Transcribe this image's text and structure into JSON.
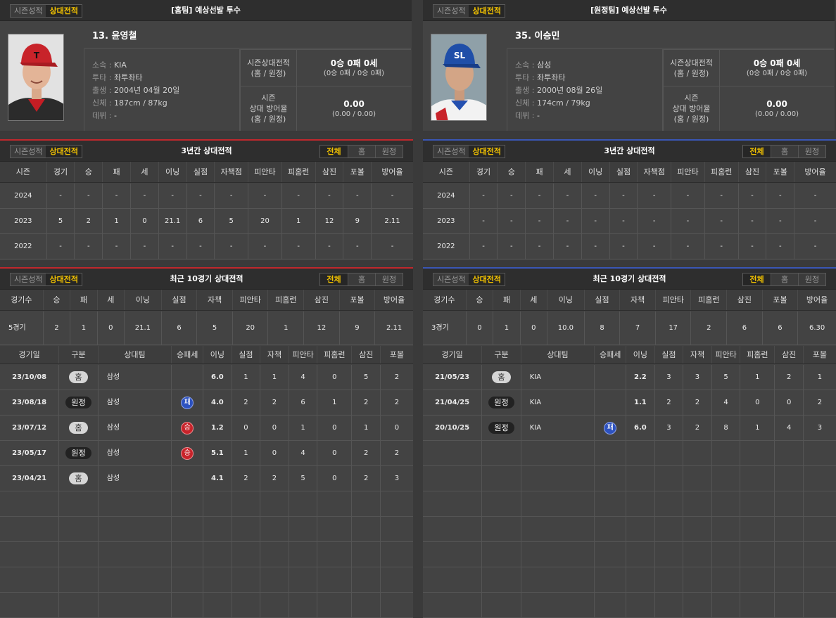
{
  "toggle": {
    "season": "시즌성적",
    "h2h": "상대전적"
  },
  "seg": {
    "all": "전체",
    "home": "홈",
    "away": "원정"
  },
  "home": {
    "title": "[홈팀] 예상선발 투수",
    "player_name": "13. 윤영철",
    "info": [
      {
        "label": "소속 : ",
        "value": "KIA"
      },
      {
        "label": "투타 : ",
        "value": "좌투좌타"
      },
      {
        "label": "출생 : ",
        "value": "2004년 04월 20일"
      },
      {
        "label": "신체 : ",
        "value": "187cm / 87kg"
      },
      {
        "label": "데뷔 : ",
        "value": "-"
      }
    ],
    "stat_record": {
      "label1": "시즌상대전적",
      "label2": "(홈 / 원정)",
      "value": "0승 0패 0세",
      "sub": "(0승 0패 / 0승 0패)"
    },
    "stat_era": {
      "label1": "시즌",
      "label2": "상대 방어율",
      "label3": "(홈 / 원정)",
      "value": "0.00",
      "sub": "(0.00 / 0.00)"
    },
    "three_year": {
      "title": "3년간 상대전적",
      "headers": [
        "시즌",
        "경기",
        "승",
        "패",
        "세",
        "이닝",
        "실점",
        "자책점",
        "피안타",
        "피홈런",
        "삼진",
        "포볼",
        "방어율"
      ],
      "rows": [
        [
          "2024",
          "-",
          "-",
          "-",
          "-",
          "-",
          "-",
          "-",
          "-",
          "-",
          "-",
          "-",
          "-"
        ],
        [
          "2023",
          "5",
          "2",
          "1",
          "0",
          "21.1",
          "6",
          "5",
          "20",
          "1",
          "12",
          "9",
          "2.11"
        ],
        [
          "2022",
          "-",
          "-",
          "-",
          "-",
          "-",
          "-",
          "-",
          "-",
          "-",
          "-",
          "-",
          "-"
        ]
      ]
    },
    "recent": {
      "title": "최근 10경기 상대전적",
      "headers": [
        "경기수",
        "승",
        "패",
        "세",
        "이닝",
        "실점",
        "자책",
        "피안타",
        "피홈런",
        "삼진",
        "포볼",
        "방어율"
      ],
      "summary": [
        "5경기",
        "2",
        "1",
        "0",
        "21.1",
        "6",
        "5",
        "20",
        "1",
        "12",
        "9",
        "2.11"
      ],
      "game_headers": [
        "경기일",
        "구분",
        "상대팀",
        "승패세",
        "이닝",
        "실점",
        "자책",
        "피안타",
        "피홈런",
        "삼진",
        "포볼"
      ],
      "games": [
        {
          "date": "23/10/08",
          "type": "홈",
          "opp": "삼성",
          "result": "",
          "ip": "6.0",
          "r": "1",
          "er": "1",
          "h": "4",
          "hr": "0",
          "so": "5",
          "bb": "2"
        },
        {
          "date": "23/08/18",
          "type": "원정",
          "opp": "삼성",
          "result": "패",
          "ip": "4.0",
          "r": "2",
          "er": "2",
          "h": "6",
          "hr": "1",
          "so": "2",
          "bb": "2"
        },
        {
          "date": "23/07/12",
          "type": "홈",
          "opp": "삼성",
          "result": "승",
          "ip": "1.2",
          "r": "0",
          "er": "0",
          "h": "1",
          "hr": "0",
          "so": "1",
          "bb": "0"
        },
        {
          "date": "23/05/17",
          "type": "원정",
          "opp": "삼성",
          "result": "승",
          "ip": "5.1",
          "r": "1",
          "er": "0",
          "h": "4",
          "hr": "0",
          "so": "2",
          "bb": "2"
        },
        {
          "date": "23/04/21",
          "type": "홈",
          "opp": "삼성",
          "result": "",
          "ip": "4.1",
          "r": "2",
          "er": "2",
          "h": "5",
          "hr": "0",
          "so": "2",
          "bb": "3"
        }
      ]
    }
  },
  "away": {
    "title": "[원정팀] 예상선발 투수",
    "player_name": "35. 이승민",
    "info": [
      {
        "label": "소속 : ",
        "value": "삼성"
      },
      {
        "label": "투타 : ",
        "value": "좌투좌타"
      },
      {
        "label": "출생 : ",
        "value": "2000년 08월 26일"
      },
      {
        "label": "신체 : ",
        "value": "174cm / 79kg"
      },
      {
        "label": "데뷔 : ",
        "value": "-"
      }
    ],
    "stat_record": {
      "label1": "시즌상대전적",
      "label2": "(홈 / 원정)",
      "value": "0승 0패 0세",
      "sub": "(0승 0패 / 0승 0패)"
    },
    "stat_era": {
      "label1": "시즌",
      "label2": "상대 방어율",
      "label3": "(홈 / 원정)",
      "value": "0.00",
      "sub": "(0.00 / 0.00)"
    },
    "three_year": {
      "title": "3년간 상대전적",
      "headers": [
        "시즌",
        "경기",
        "승",
        "패",
        "세",
        "이닝",
        "실점",
        "자책점",
        "피안타",
        "피홈런",
        "삼진",
        "포볼",
        "방어율"
      ],
      "rows": [
        [
          "2024",
          "-",
          "-",
          "-",
          "-",
          "-",
          "-",
          "-",
          "-",
          "-",
          "-",
          "-",
          "-"
        ],
        [
          "2023",
          "-",
          "-",
          "-",
          "-",
          "-",
          "-",
          "-",
          "-",
          "-",
          "-",
          "-",
          "-"
        ],
        [
          "2022",
          "-",
          "-",
          "-",
          "-",
          "-",
          "-",
          "-",
          "-",
          "-",
          "-",
          "-",
          "-"
        ]
      ]
    },
    "recent": {
      "title": "최근 10경기 상대전적",
      "headers": [
        "경기수",
        "승",
        "패",
        "세",
        "이닝",
        "실점",
        "자책",
        "피안타",
        "피홈런",
        "삼진",
        "포볼",
        "방어율"
      ],
      "summary": [
        "3경기",
        "0",
        "1",
        "0",
        "10.0",
        "8",
        "7",
        "17",
        "2",
        "6",
        "6",
        "6.30"
      ],
      "game_headers": [
        "경기일",
        "구분",
        "상대팀",
        "승패세",
        "이닝",
        "실점",
        "자책",
        "피안타",
        "피홈런",
        "삼진",
        "포볼"
      ],
      "games": [
        {
          "date": "21/05/23",
          "type": "홈",
          "opp": "KIA",
          "result": "",
          "ip": "2.2",
          "r": "3",
          "er": "3",
          "h": "5",
          "hr": "1",
          "so": "2",
          "bb": "1"
        },
        {
          "date": "21/04/25",
          "type": "원정",
          "opp": "KIA",
          "result": "",
          "ip": "1.1",
          "r": "2",
          "er": "2",
          "h": "4",
          "hr": "0",
          "so": "0",
          "bb": "2"
        },
        {
          "date": "20/10/25",
          "type": "원정",
          "opp": "KIA",
          "result": "패",
          "ip": "6.0",
          "r": "3",
          "er": "2",
          "h": "8",
          "hr": "1",
          "so": "4",
          "bb": "3"
        }
      ]
    }
  },
  "colors": {
    "home_accent": "#c0282d",
    "away_accent": "#3a56b5",
    "toggle_active": "#f2c200",
    "loss_badge": "#2d52c0",
    "win_badge": "#c8232a"
  }
}
